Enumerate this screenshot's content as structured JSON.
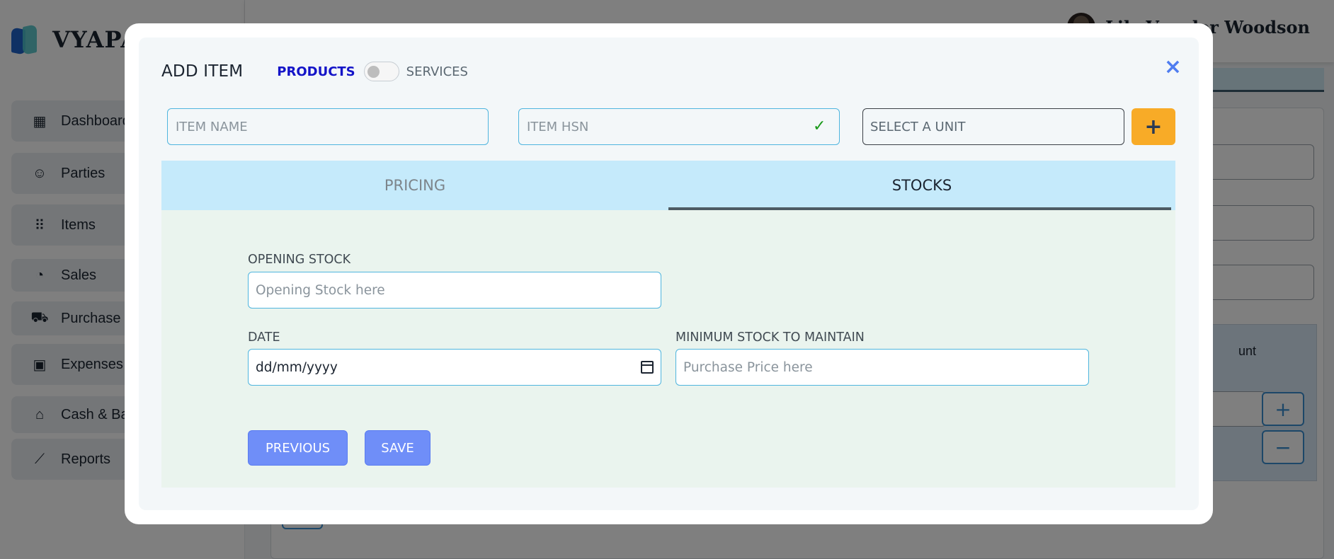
{
  "app": {
    "brand": "VYAPAR",
    "user_name": "Lily Van der Woodson",
    "sidebar": [
      {
        "label": "Dashboard",
        "icon": "dashboard-icon",
        "glyph": "▦"
      },
      {
        "label": "Parties",
        "icon": "users-icon",
        "glyph": "☺"
      },
      {
        "label": "Items",
        "icon": "grid-icon",
        "glyph": "⠿"
      },
      {
        "label": "Sales",
        "icon": "speedometer-icon",
        "glyph": "◔"
      },
      {
        "label": "Purchase",
        "icon": "cart-icon",
        "glyph": "⛟"
      },
      {
        "label": "Expenses",
        "icon": "wallet-icon",
        "glyph": "▣"
      },
      {
        "label": "Cash & Bank",
        "icon": "bank-icon",
        "glyph": "⌂"
      },
      {
        "label": "Reports",
        "icon": "chart-line-icon",
        "glyph": "⟋"
      }
    ],
    "table_header_fragment": "unt",
    "plus": "+",
    "minus": "−"
  },
  "modal": {
    "title": "ADD ITEM",
    "toggle_left": "PRODUCTS",
    "toggle_right": "SERVICES",
    "toggle_state": "products",
    "close": "×",
    "item_name_placeholder": "ITEM NAME",
    "item_hsn_placeholder": "ITEM HSN",
    "hsn_check": "✓",
    "unit_select": "SELECT A UNIT",
    "add_unit": "+",
    "tabs": [
      {
        "label": "PRICING",
        "active": false
      },
      {
        "label": "STOCKS",
        "active": true
      }
    ],
    "stocks": {
      "opening_stock_label": "OPENING STOCK",
      "opening_stock_placeholder": "Opening Stock here",
      "date_label": "DATE",
      "date_value": "dd/mm/yyyy",
      "min_stock_label": "MINIMUM STOCK TO MAINTAIN",
      "min_stock_placeholder": "Purchase Price here"
    },
    "buttons": {
      "previous": "PREVIOUS",
      "save": "SAVE"
    }
  }
}
